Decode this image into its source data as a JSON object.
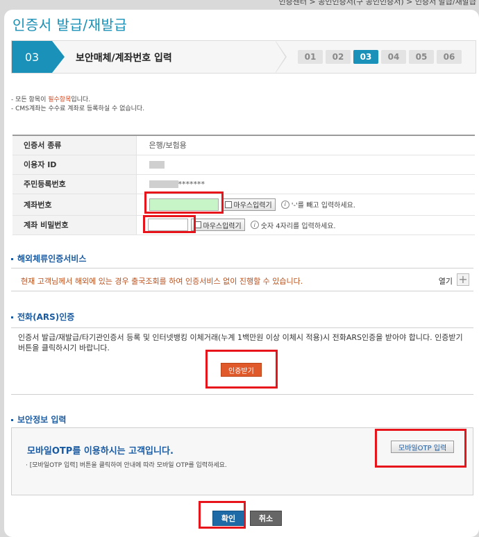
{
  "breadcrumb": "인증센터 > 공인인증서(구 공인인증서) > 인증서 발급/재발급",
  "page_title": "인증서 발급/재발급",
  "stepbar": {
    "current_step": "03",
    "title": "보안매체/계좌번호 입력",
    "steps": [
      "01",
      "02",
      "03",
      "04",
      "05",
      "06"
    ]
  },
  "notes": {
    "line1_prefix": "- 모든 항목이 ",
    "line1_required": "필수항목",
    "line1_suffix": "입니다.",
    "line2": "- CMS계좌는 수수료 계좌로 등록하실 수 없습니다."
  },
  "form": {
    "cert_type_label": "인증서 종류",
    "cert_type_value": "은행/보험용",
    "user_id_label": "이용자 ID",
    "resident_label": "주민등록번호",
    "resident_masked": "*******",
    "account_label": "계좌번호",
    "account_pw_label": "계좌 비밀번호",
    "mouse_input": "마우스입력기",
    "account_hint": "'-'를 빼고 입력하세요.",
    "pw_hint": "숫자 4자리를 입력하세요."
  },
  "overseas": {
    "heading": "해외체류인증서비스",
    "text": "현재 고객님께서 해외에 있는 경우 출국조회를 하여 인증서비스 없이 진행할 수 있습니다.",
    "open": "열기"
  },
  "ars": {
    "heading": "전화(ARS)인증",
    "text": "인증서 발급/재발급/타기관인증서 등록 및 인터넷뱅킹 이체거래(누계 1백만원 이상 이체시 적용)시 전화ARS인증을 받아야 합니다. 인증받기 버튼을 클릭하시기 바랍니다.",
    "button": "인증받기"
  },
  "security": {
    "heading": "보안정보 입력",
    "title": "모바일OTP를 이용하시는 고객입니다.",
    "desc": "· [모바일OTP 입력] 버튼을 클릭하여 안내에 따라 모바일 OTP를 입력하세요.",
    "otp_button": "모바일OTP 입력"
  },
  "buttons": {
    "confirm": "확인",
    "cancel": "취소"
  },
  "colors": {
    "accent": "#1991b8",
    "highlight_box": "#e8141b",
    "orange_text": "#b8501d",
    "account_input_bg": "#c8f5c8"
  }
}
